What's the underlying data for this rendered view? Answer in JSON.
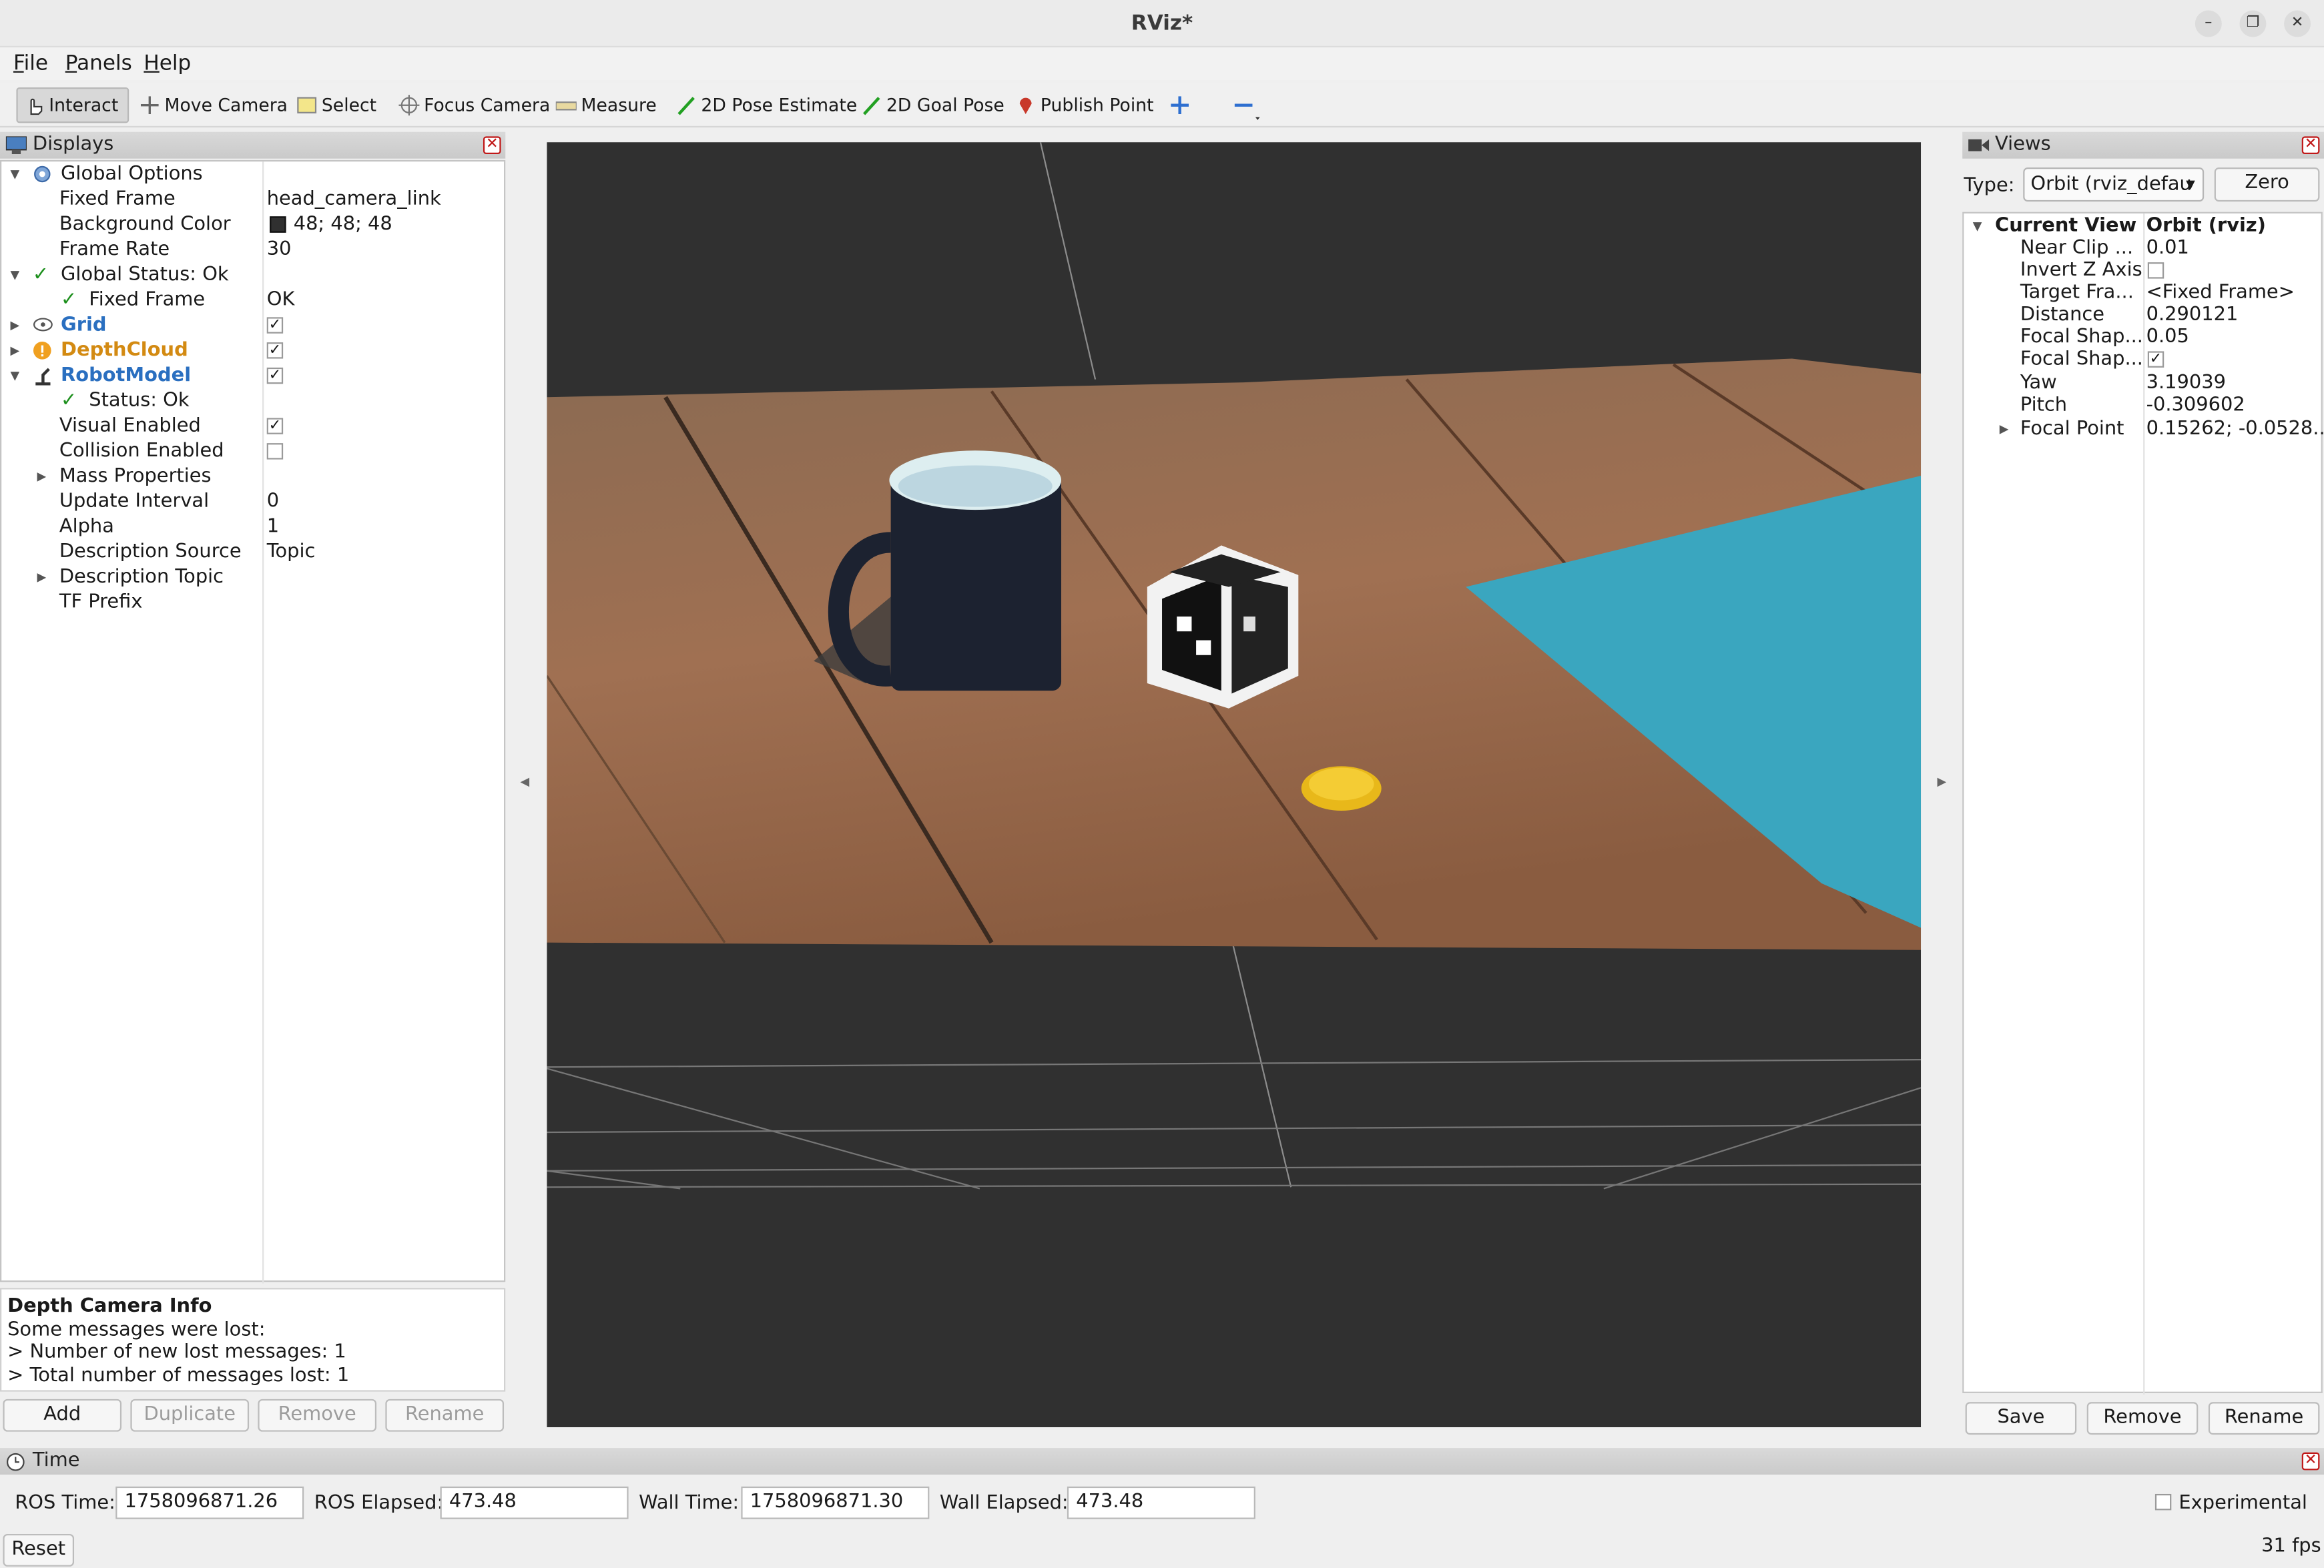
{
  "window": {
    "title": "RViz*"
  },
  "menu": {
    "file": "File",
    "panels": "Panels",
    "help": "Help"
  },
  "toolbar": {
    "interact": "Interact",
    "move_camera": "Move Camera",
    "select": "Select",
    "focus_camera": "Focus Camera",
    "measure": "Measure",
    "pose_estimate": "2D Pose Estimate",
    "goal_pose": "2D Goal Pose",
    "publish_point": "Publish Point"
  },
  "displays": {
    "title": "Displays",
    "global_options": "Global Options",
    "fixed_frame_label": "Fixed Frame",
    "fixed_frame_value": "head_camera_link",
    "bg_color_label": "Background Color",
    "bg_color_value": "48; 48; 48",
    "bg_color_swatch": "#303030",
    "frame_rate_label": "Frame Rate",
    "frame_rate_value": "30",
    "global_status": "Global Status: Ok",
    "fixed_frame_status_label": "Fixed Frame",
    "fixed_frame_status_value": "OK",
    "grid": "Grid",
    "depthcloud": "DepthCloud",
    "robotmodel": "RobotModel",
    "status": "Status: Ok",
    "visual_enabled": "Visual Enabled",
    "collision_enabled": "Collision Enabled",
    "mass_properties": "Mass Properties",
    "update_interval_label": "Update Interval",
    "update_interval_value": "0",
    "alpha_label": "Alpha",
    "alpha_value": "1",
    "desc_source_label": "Description Source",
    "desc_source_value": "Topic",
    "desc_topic": "Description Topic",
    "tf_prefix": "TF Prefix"
  },
  "info": {
    "title": "Depth Camera Info",
    "line1": "Some messages were lost:",
    "line2": "> Number of new lost messages: 1",
    "line3": "> Total number of messages lost: 1"
  },
  "display_buttons": {
    "add": "Add",
    "duplicate": "Duplicate",
    "remove": "Remove",
    "rename": "Rename"
  },
  "views": {
    "title": "Views",
    "type_label": "Type:",
    "type_value": "Orbit (rviz_defau",
    "zero": "Zero",
    "current_view": "Current View",
    "current_view_value": "Orbit (rviz)",
    "props": [
      {
        "label": "Near Clip ...",
        "value": "0.01"
      },
      {
        "label": "Invert Z Axis",
        "value": ""
      },
      {
        "label": "Target Fra...",
        "value": "<Fixed Frame>"
      },
      {
        "label": "Distance",
        "value": "0.290121"
      },
      {
        "label": "Focal Shap...",
        "value": "0.05"
      },
      {
        "label": "Focal Shap...",
        "value": ""
      },
      {
        "label": "Yaw",
        "value": "3.19039"
      },
      {
        "label": "Pitch",
        "value": "-0.309602"
      },
      {
        "label": "Focal Point",
        "value": "0.15262; -0.0528..."
      }
    ],
    "save": "Save",
    "remove": "Remove",
    "rename": "Rename"
  },
  "time": {
    "title": "Time",
    "ros_time_label": "ROS Time:",
    "ros_time_value": "1758096871.26",
    "ros_elapsed_label": "ROS Elapsed:",
    "ros_elapsed_value": "473.48",
    "wall_time_label": "Wall Time:",
    "wall_time_value": "1758096871.30",
    "wall_elapsed_label": "Wall Elapsed:",
    "wall_elapsed_value": "473.48",
    "experimental": "Experimental",
    "reset": "Reset",
    "fps": "31 fps"
  }
}
